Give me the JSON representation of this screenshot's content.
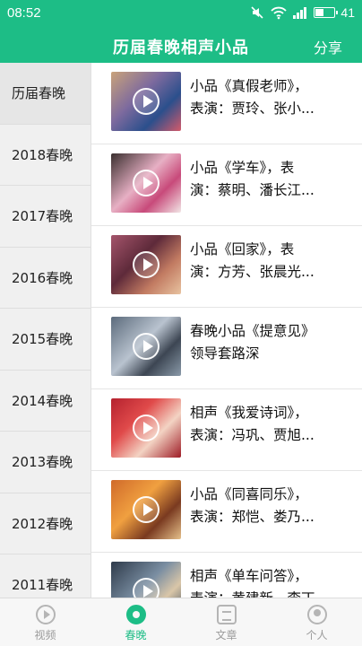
{
  "status_bar": {
    "time": "08:52",
    "battery": "41"
  },
  "header": {
    "title": "历届春晚相声小品",
    "share_label": "分享"
  },
  "sidebar": {
    "items": [
      {
        "label": "历届春晚"
      },
      {
        "label": "2018春晚"
      },
      {
        "label": "2017春晚"
      },
      {
        "label": "2016春晚"
      },
      {
        "label": "2015春晚"
      },
      {
        "label": "2014春晚"
      },
      {
        "label": "2013春晚"
      },
      {
        "label": "2012春晚"
      },
      {
        "label": "2011春晚"
      }
    ]
  },
  "videos": [
    {
      "title": "小品《真假老师》，\n表演：贾玲、张小..."
    },
    {
      "title": "小品《学车》，表\n演：蔡明、潘长江..."
    },
    {
      "title": "小品《回家》，表\n演：方芳、张晨光..."
    },
    {
      "title": "春晚小品《提意见》\n领导套路深"
    },
    {
      "title": "相声《我爱诗词》，\n表演：冯巩、贾旭..."
    },
    {
      "title": "小品《同喜同乐》，\n表演：郑恺、娄乃..."
    },
    {
      "title": "相声《单车问答》，\n表演：黄建新、李丁..."
    }
  ],
  "tabs": [
    {
      "label": "视频",
      "icon": "video-icon"
    },
    {
      "label": "春晚",
      "icon": "gala-icon"
    },
    {
      "label": "文章",
      "icon": "article-icon"
    },
    {
      "label": "个人",
      "icon": "person-icon"
    }
  ],
  "colors": {
    "accent": "#1dbd86"
  }
}
